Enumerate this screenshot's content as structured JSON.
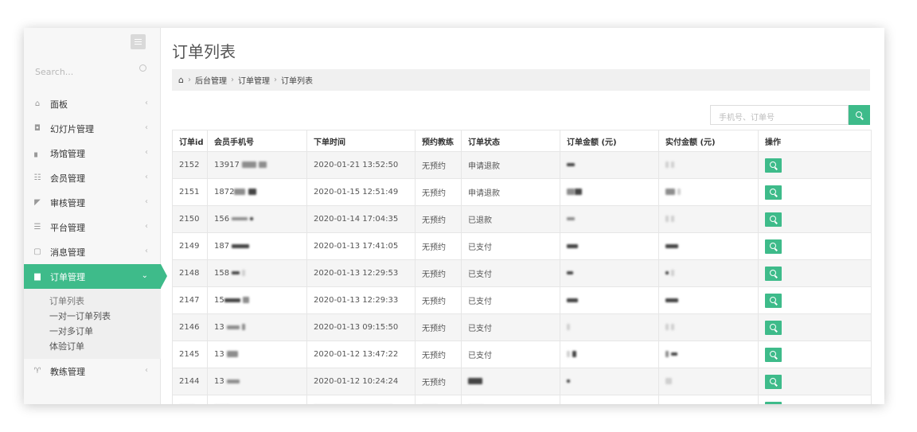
{
  "sidebar": {
    "search_placeholder": "Search...",
    "menu": [
      {
        "label": "面板",
        "icon": "home-icon"
      },
      {
        "label": "幻灯片管理",
        "icon": "camera-icon"
      },
      {
        "label": "场馆管理",
        "icon": "venue-icon"
      },
      {
        "label": "会员管理",
        "icon": "users-icon"
      },
      {
        "label": "审核管理",
        "icon": "gavel-icon"
      },
      {
        "label": "平台管理",
        "icon": "sliders-icon"
      },
      {
        "label": "消息管理",
        "icon": "message-icon"
      },
      {
        "label": "订单管理",
        "icon": "cart-icon"
      }
    ],
    "submenu": [
      "订单列表",
      "一对一订单列表",
      "一对多订单",
      "体验订单"
    ],
    "last_menu": {
      "label": "教练管理",
      "icon": "trophy-icon"
    }
  },
  "page": {
    "title": "订单列表",
    "breadcrumb": [
      "后台管理",
      "订单管理",
      "订单列表"
    ],
    "search_placeholder": "手机号、订单号"
  },
  "table": {
    "headers": [
      "订单id",
      "会员手机号",
      "下单时间",
      "预约教练",
      "订单状态",
      "订单金额 (元)",
      "实付金额 (元)",
      "操作"
    ],
    "rows": [
      {
        "id": "2152",
        "phone": "13917",
        "time": "2020-01-21 13:52:50",
        "coach": "无预约",
        "status": "申请退款"
      },
      {
        "id": "2151",
        "phone": "1872",
        "time": "2020-01-15 12:51:49",
        "coach": "无预约",
        "status": "申请退款"
      },
      {
        "id": "2150",
        "phone": "156",
        "time": "2020-01-14 17:04:35",
        "coach": "无预约",
        "status": "已退款"
      },
      {
        "id": "2149",
        "phone": "187",
        "time": "2020-01-13 17:41:05",
        "coach": "无预约",
        "status": "已支付"
      },
      {
        "id": "2148",
        "phone": "158",
        "time": "2020-01-13 12:29:53",
        "coach": "无预约",
        "status": "已支付"
      },
      {
        "id": "2147",
        "phone": "15",
        "time": "2020-01-13 12:29:33",
        "coach": "无预约",
        "status": "已支付"
      },
      {
        "id": "2146",
        "phone": "13",
        "time": "2020-01-13 09:15:50",
        "coach": "无预约",
        "status": "已支付"
      },
      {
        "id": "2145",
        "phone": "13",
        "time": "2020-01-12 13:47:22",
        "coach": "无预约",
        "status": "已支付"
      },
      {
        "id": "2144",
        "phone": "13",
        "time": "2020-01-12 10:24:24",
        "coach": "无预约",
        "status": ""
      }
    ]
  },
  "colors": {
    "accent": "#3ebb8a"
  }
}
